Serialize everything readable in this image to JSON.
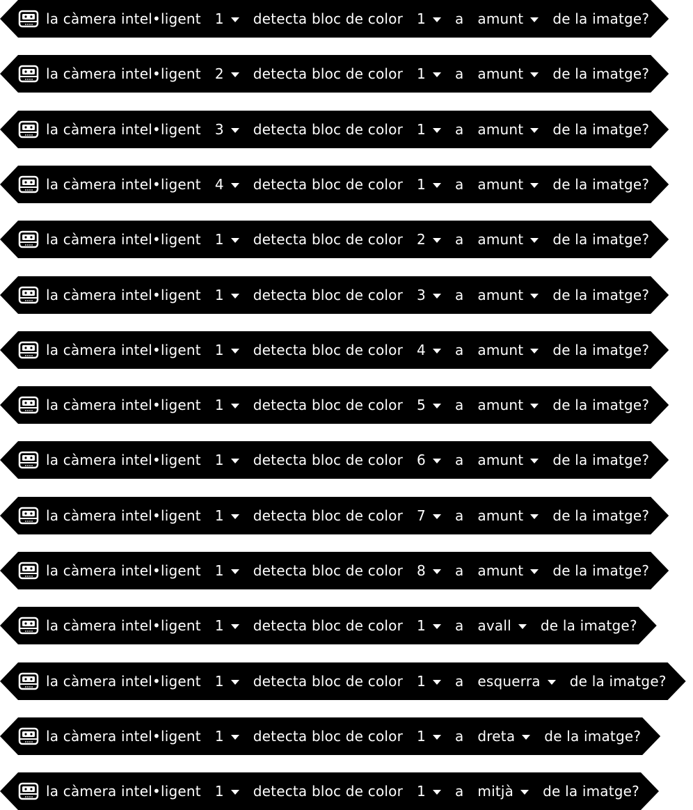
{
  "labels": {
    "prefix": "la càmera intel•ligent",
    "mid": "detecta bloc de color",
    "preposition": "a",
    "suffix": "de la imatge?"
  },
  "icon": "smart-camera-icon",
  "colors": {
    "block_bg": "#000000",
    "text": "#ffffff",
    "page_bg": "#ffffff"
  },
  "blocks": [
    {
      "camera": "1",
      "color_block": "1",
      "position": "amunt"
    },
    {
      "camera": "2",
      "color_block": "1",
      "position": "amunt"
    },
    {
      "camera": "3",
      "color_block": "1",
      "position": "amunt"
    },
    {
      "camera": "4",
      "color_block": "1",
      "position": "amunt"
    },
    {
      "camera": "1",
      "color_block": "2",
      "position": "amunt"
    },
    {
      "camera": "1",
      "color_block": "3",
      "position": "amunt"
    },
    {
      "camera": "1",
      "color_block": "4",
      "position": "amunt"
    },
    {
      "camera": "1",
      "color_block": "5",
      "position": "amunt"
    },
    {
      "camera": "1",
      "color_block": "6",
      "position": "amunt"
    },
    {
      "camera": "1",
      "color_block": "7",
      "position": "amunt"
    },
    {
      "camera": "1",
      "color_block": "8",
      "position": "amunt"
    },
    {
      "camera": "1",
      "color_block": "1",
      "position": "avall"
    },
    {
      "camera": "1",
      "color_block": "1",
      "position": "esquerra"
    },
    {
      "camera": "1",
      "color_block": "1",
      "position": "dreta"
    },
    {
      "camera": "1",
      "color_block": "1",
      "position": "mitjà"
    }
  ]
}
